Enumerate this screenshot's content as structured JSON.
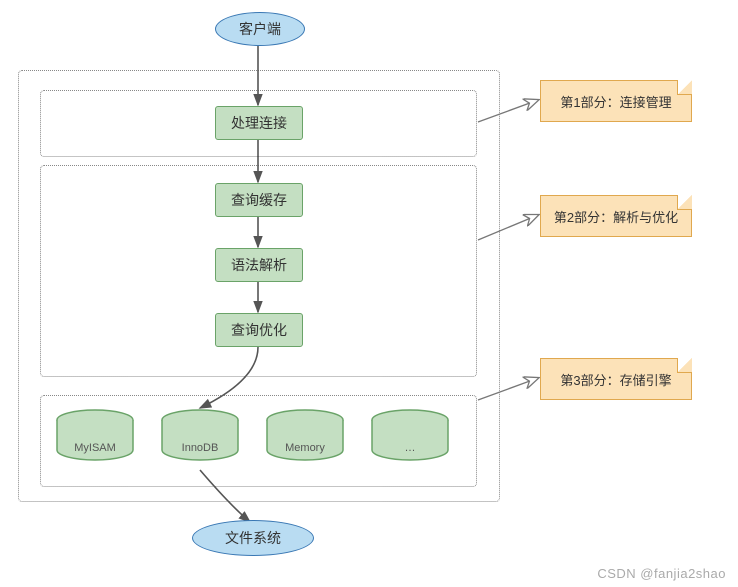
{
  "chart_data": {
    "type": "diagram",
    "title": "",
    "nodes": {
      "client": {
        "label": "客户端",
        "shape": "ellipse",
        "fill": "#b9dcf2",
        "stroke": "#3a78b4"
      },
      "handle_conn": {
        "label": "处理连接",
        "shape": "rect",
        "fill": "#c4dfc2",
        "stroke": "#6aa368"
      },
      "query_cache": {
        "label": "查询缓存",
        "shape": "rect",
        "fill": "#c4dfc2",
        "stroke": "#6aa368"
      },
      "parse": {
        "label": "语法解析",
        "shape": "rect",
        "fill": "#c4dfc2",
        "stroke": "#6aa368"
      },
      "optimize": {
        "label": "查询优化",
        "shape": "rect",
        "fill": "#c4dfc2",
        "stroke": "#6aa368"
      },
      "eng_myisam": {
        "label": "MyISAM",
        "shape": "cylinder",
        "fill": "#c4dfc2",
        "stroke": "#6aa368"
      },
      "eng_innodb": {
        "label": "InnoDB",
        "shape": "cylinder",
        "fill": "#c4dfc2",
        "stroke": "#6aa368"
      },
      "eng_memory": {
        "label": "Memory",
        "shape": "cylinder",
        "fill": "#c4dfc2",
        "stroke": "#6aa368"
      },
      "eng_more": {
        "label": "…",
        "shape": "cylinder",
        "fill": "#c4dfc2",
        "stroke": "#6aa368"
      },
      "filesystem": {
        "label": "文件系统",
        "shape": "ellipse",
        "fill": "#b9dcf2",
        "stroke": "#3a78b4"
      }
    },
    "groups": [
      {
        "id": "outer",
        "contains": [
          "handle_conn",
          "query_cache",
          "parse",
          "optimize",
          "eng_myisam",
          "eng_innodb",
          "eng_memory",
          "eng_more"
        ],
        "style": "dotted"
      },
      {
        "id": "g_conn",
        "contains": [
          "handle_conn"
        ],
        "style": "dotted",
        "annotation": "第1部分：连接管理"
      },
      {
        "id": "g_parse",
        "contains": [
          "query_cache",
          "parse",
          "optimize"
        ],
        "style": "dotted",
        "annotation": "第2部分：解析与优化"
      },
      {
        "id": "g_engine",
        "contains": [
          "eng_myisam",
          "eng_innodb",
          "eng_memory",
          "eng_more"
        ],
        "style": "dotted",
        "annotation": "第3部分：存储引擎"
      }
    ],
    "edges": [
      {
        "from": "client",
        "to": "handle_conn"
      },
      {
        "from": "handle_conn",
        "to": "query_cache"
      },
      {
        "from": "query_cache",
        "to": "parse"
      },
      {
        "from": "parse",
        "to": "optimize"
      },
      {
        "from": "optimize",
        "to": "eng_innodb"
      },
      {
        "from": "eng_innodb",
        "to": "filesystem"
      }
    ],
    "callouts": [
      {
        "from_group": "g_conn",
        "label": "第1部分：连接管理"
      },
      {
        "from_group": "g_parse",
        "label": "第2部分：解析与优化"
      },
      {
        "from_group": "g_engine",
        "label": "第3部分：存储引擎"
      }
    ]
  },
  "footer": "CSDN @fanjia2shao"
}
